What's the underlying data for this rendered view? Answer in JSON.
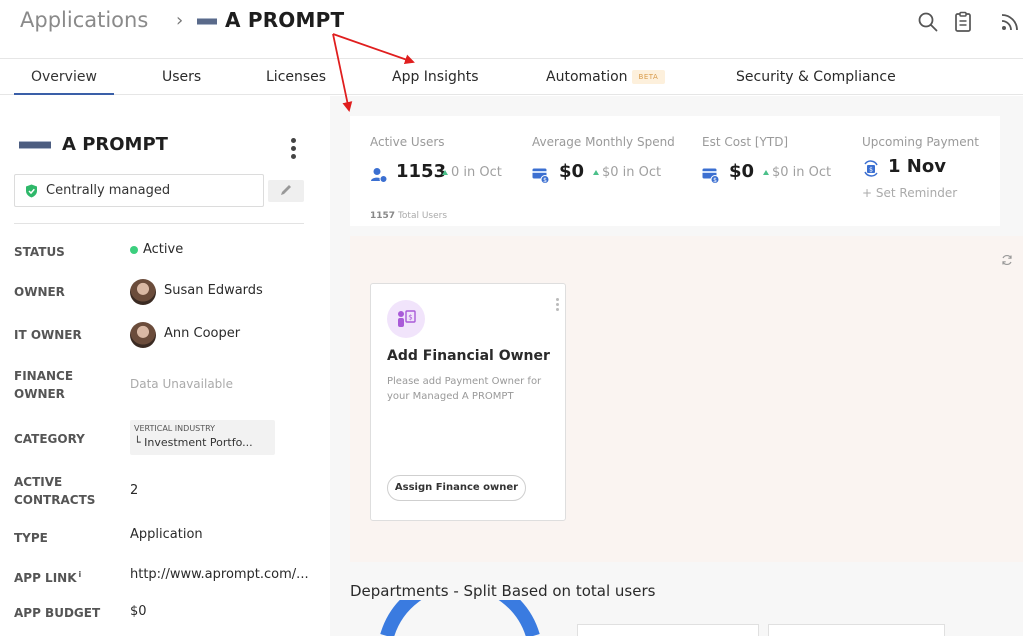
{
  "header": {
    "breadcrumb_root": "Applications",
    "breadcrumb_separator": "›",
    "app_name": "A PROMPT",
    "icons": [
      "search-icon",
      "clipboard-icon",
      "rss-icon"
    ]
  },
  "tabs": [
    {
      "label": "Overview",
      "active": true
    },
    {
      "label": "Users"
    },
    {
      "label": "Licenses"
    },
    {
      "label": "App Insights"
    },
    {
      "label": "Automation",
      "badge": "BETA"
    },
    {
      "label": "Security & Compliance"
    }
  ],
  "app_panel": {
    "name": "A PROMPT",
    "managed_status": "Centrally managed",
    "fields": {
      "status_label": "STATUS",
      "status_value": "Active",
      "owner_label": "OWNER",
      "owner_value": "Susan Edwards",
      "it_owner_label": "IT OWNER",
      "it_owner_value": "Ann Cooper",
      "finance_owner_label_1": "FINANCE",
      "finance_owner_label_2": "OWNER",
      "finance_owner_value": "Data Unavailable",
      "category_label": "CATEGORY",
      "category_parent": "VERTICAL INDUSTRY",
      "category_child": "└ Investment Portfo...",
      "active_contracts_label_1": "ACTIVE",
      "active_contracts_label_2": "CONTRACTS",
      "active_contracts_value": "2",
      "type_label": "TYPE",
      "type_value": "Application",
      "app_link_label": "APP LINK",
      "app_link_info": "i",
      "app_link_value": "http://www.aprompt.com/...",
      "app_budget_label": "APP BUDGET",
      "app_budget_value": "$0"
    }
  },
  "stats": {
    "active_users": {
      "title": "Active Users",
      "value": "1153",
      "delta": "0 in Oct",
      "sub_value": "1157",
      "sub_label": "Total Users"
    },
    "avg_spend": {
      "title": "Average Monthly Spend",
      "value": "$0",
      "delta": "$0 in Oct"
    },
    "est_cost": {
      "title": "Est Cost [YTD]",
      "value": "$0",
      "delta": "$0 in Oct"
    },
    "upcoming_payment": {
      "title": "Upcoming Payment",
      "value": "1 Nov",
      "reminder": "+ Set Reminder"
    }
  },
  "finance_card": {
    "title": "Add Financial Owner",
    "description": "Please add Payment Owner for your Managed A PROMPT",
    "button": "Assign Finance owner"
  },
  "departments": {
    "title": "Departments - Split Based on total users"
  },
  "colors": {
    "accent": "#3a5fa8",
    "active_dot": "#3ccf7e",
    "delta_up": "#4bc08a",
    "annotation_arrow": "#e01e1e",
    "card_icon_bg": "#f1e4fb"
  }
}
